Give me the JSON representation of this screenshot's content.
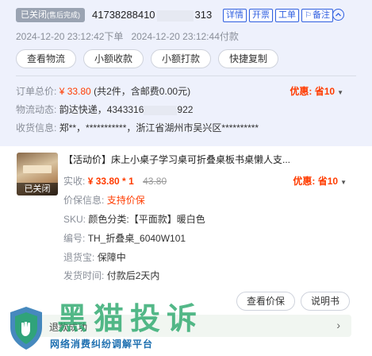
{
  "order": {
    "status_main": "已关闭",
    "status_sub": "(售后完成)",
    "order_id_prefix": "41738288410",
    "order_id_suffix": "313",
    "tags": [
      {
        "icon": "",
        "label": "详情"
      },
      {
        "icon": "",
        "label": "开票"
      },
      {
        "icon": "",
        "label": "工单"
      },
      {
        "icon": "flag-icon",
        "label": "备注"
      }
    ],
    "order_time": "2024-12-20 23:12:42下单",
    "pay_time": "2024-12-20 23:12:44付款",
    "actions": [
      "查看物流",
      "小额收款",
      "小额打款",
      "快捷复制"
    ],
    "total_label": "订单总价:",
    "total_price": "¥ 33.80",
    "total_detail": "(共2件，含邮费0.00元)",
    "discount_label": "优惠: 省10",
    "logistics_label": "物流动态:",
    "logistics_value": "韵达快递，4343316",
    "logistics_suffix": "922",
    "address_label": "收货信息:",
    "address_value": "郑**，***********，浙江省湖州市吴兴区**********"
  },
  "product": {
    "thumb_status": "已关闭",
    "title": "【活动价】床上小桌子学习桌可折叠桌板书桌懒人支...",
    "paid_label": "实收:",
    "paid_value": "¥ 33.80 * 1",
    "original_price": "43.80",
    "discount_label": "优惠: 省10",
    "protect_label": "价保信息:",
    "protect_value": "支持价保",
    "sku_label": "SKU:",
    "sku_value": "颜色分类:【平面款】暖白色",
    "code_label": "编号:",
    "code_value": "TH_折叠桌_6040W101",
    "refund_treasure_label": "退货宝:",
    "refund_treasure_value": "保障中",
    "ship_label": "发货时间:",
    "ship_value": "付款后2天内",
    "actions": [
      "查看价保",
      "说明书"
    ],
    "refund_bar_label": "退款成功"
  },
  "watermark": {
    "title": "黑猫投诉",
    "subtitle": "网络消费纠纷调解平台"
  },
  "colors": {
    "accent_blue": "#2f5fe0",
    "price_red": "#ff3c00",
    "header_bg": "#eef1fc"
  }
}
